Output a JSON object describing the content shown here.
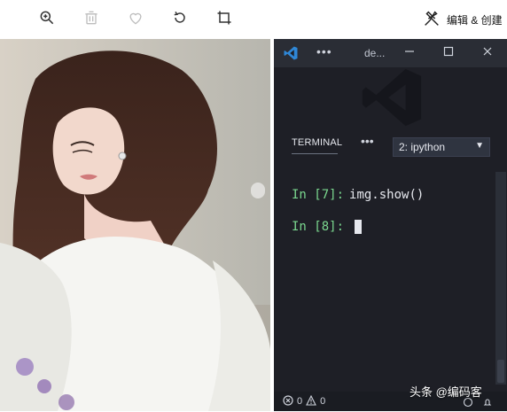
{
  "toolbar": {
    "zoom_icon": "zoom-in-icon",
    "delete_icon": "trash-icon",
    "favorite_icon": "heart-icon",
    "rotate_icon": "rotate-icon",
    "crop_icon": "crop-icon",
    "edit_create_label": "编辑 & 创建"
  },
  "vscode": {
    "title": "de...",
    "tabs": {
      "terminal_label": "TERMINAL",
      "more": "•••",
      "selected_terminal": "2: ipython"
    },
    "terminal": {
      "lines": [
        {
          "prompt": "In [7]:",
          "code": "img.show()"
        },
        {
          "prompt": "In [8]:",
          "code": ""
        }
      ]
    },
    "status": {
      "errors": "0",
      "warnings": "0"
    }
  },
  "overlay": {
    "brand_text": "头条 @编码客"
  },
  "colors": {
    "accent_vscode_blue": "#2f87d6",
    "prompt_green": "#7bd88f",
    "terminal_bg": "#1e1f26"
  }
}
